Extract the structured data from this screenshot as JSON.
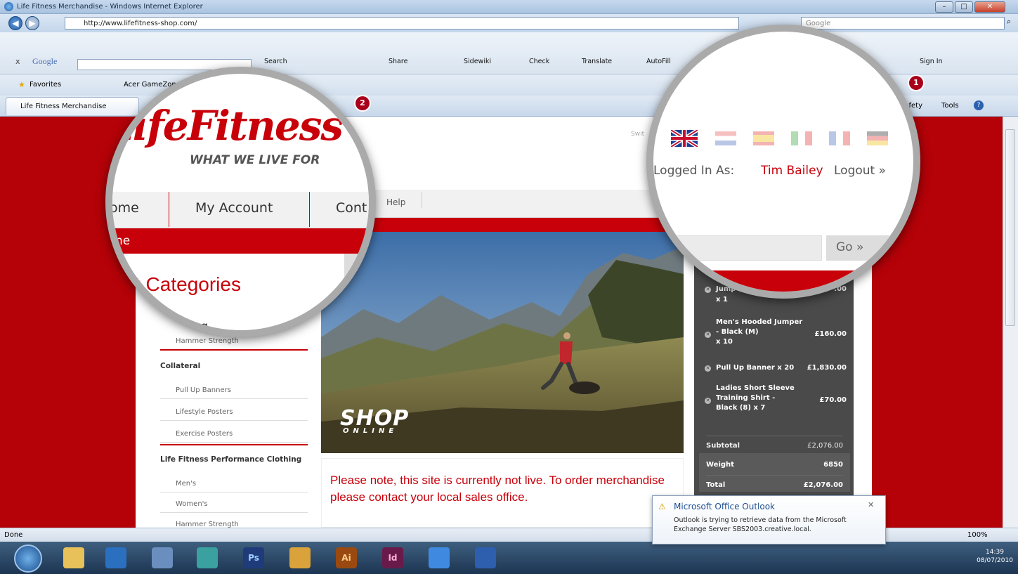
{
  "browser": {
    "window_title": "Life Fitness Merchandise - Windows Internet Explorer",
    "address": "http://www.lifefitness-shop.com/",
    "search_placeholder": "Google",
    "tab_title": "Life Fitness Merchandise",
    "status": "Done",
    "zoom": "100%"
  },
  "google_toolbar": {
    "close": "x",
    "brand": "Google",
    "items": [
      "Search",
      "Share",
      "Sidewiki",
      "Check",
      "Translate",
      "AutoFill"
    ],
    "sign_in": "Sign In"
  },
  "favorites_bar": {
    "favorites": "Favorites",
    "items": [
      "Acer GameZone"
    ]
  },
  "command_bar": {
    "safety": "Safety",
    "tools": "Tools"
  },
  "site": {
    "logo": "LifeFitness",
    "tagline": "WHAT WE LIVE FOR",
    "nav": [
      "ome",
      "My Account",
      "Cont"
    ],
    "help": "Help",
    "breadcrumb": "ne",
    "categories_title": "ct Categories",
    "partial_heading": "ing",
    "switch": "Swit",
    "languages": [
      "English",
      "Dutch",
      "Spanish",
      "Italian",
      "French",
      "German"
    ],
    "logged_in_label": "Logged In As:",
    "user": "Tim Bailey",
    "logout": "Logout »",
    "search_go": "Go »",
    "categories": [
      {
        "heading": "",
        "items": [
          "Hammer Strength"
        ]
      },
      {
        "heading": "Collateral",
        "items": [
          "Pull Up Banners",
          "Lifestyle Posters",
          "Exercise Posters"
        ]
      },
      {
        "heading": "Life Fitness Performance Clothing",
        "items": [
          "Men's",
          "Women's",
          "Hammer Strength"
        ]
      }
    ],
    "hero_title": "SHOP",
    "hero_subtitle": "ONLINE",
    "notice": "Please note, this site is currently not live. To order merchandise please contact your local sales office."
  },
  "basket": {
    "items": [
      {
        "name": "Jump",
        "qty": "x 1",
        "price": ".00"
      },
      {
        "name": "Men's Hooded Jumper - Black (M)",
        "qty": "x 10",
        "price": "£160.00"
      },
      {
        "name": "Pull Up Banner x 20",
        "qty": "",
        "price": "£1,830.00"
      },
      {
        "name": "Ladies Short Sleeve Training Shirt - Black (8) x 7",
        "qty": "",
        "price": "£70.00"
      }
    ],
    "subtotal_label": "Subtotal",
    "subtotal": "£2,076.00",
    "weight_label": "Weight",
    "weight": "6850",
    "total_label": "Total",
    "total": "£2,076.00"
  },
  "notification": {
    "title": "Microsoft Office Outlook",
    "body": "Outlook is trying to retrieve data from the Microsoft Exchange Server SBS2003.creative.local."
  },
  "clock": {
    "time": "14:39",
    "date": "08/07/2010"
  },
  "callouts": [
    "1",
    "2"
  ],
  "colors": {
    "brand_red": "#c8000a",
    "dark_red": "#b40208",
    "basket_bg": "#4a4a4a"
  }
}
